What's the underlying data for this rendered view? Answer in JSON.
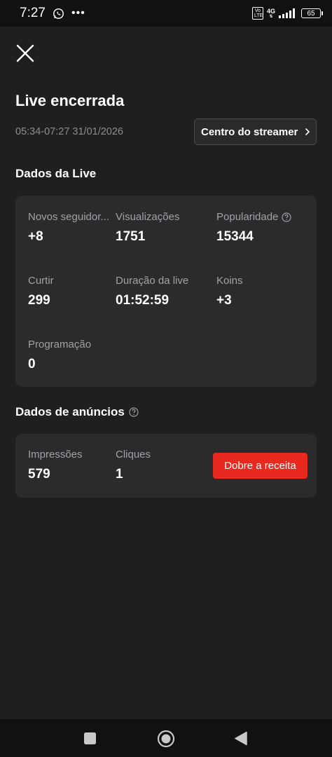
{
  "status_bar": {
    "time": "7:27",
    "dots": "•••",
    "volte": "Vo LTE",
    "network": "4G",
    "battery": "65"
  },
  "header": {
    "title": "Live encerrada",
    "time_range": "05:34-07:27  31/01/2026",
    "streamer_button": "Centro do streamer"
  },
  "live_data": {
    "title": "Dados da Live",
    "metrics": [
      {
        "label": "Novos seguidor...",
        "value": "+8"
      },
      {
        "label": "Visualizações",
        "value": "1751"
      },
      {
        "label": "Popularidade",
        "value": "15344"
      },
      {
        "label": "Curtir",
        "value": "299"
      },
      {
        "label": "Duração da live",
        "value": "01:52:59"
      },
      {
        "label": "Koins",
        "value": "+3"
      },
      {
        "label": "Programação",
        "value": "0"
      }
    ]
  },
  "ads_data": {
    "title": "Dados de anúncios",
    "metrics": [
      {
        "label": "Impressões",
        "value": "579"
      },
      {
        "label": "Cliques",
        "value": "1"
      }
    ],
    "cta_button": "Dobre a receita"
  },
  "colors": {
    "background": "#1f1f21",
    "card": "#2b2b2e",
    "accent": "#e8291f",
    "muted_text": "#a2a2a7"
  }
}
